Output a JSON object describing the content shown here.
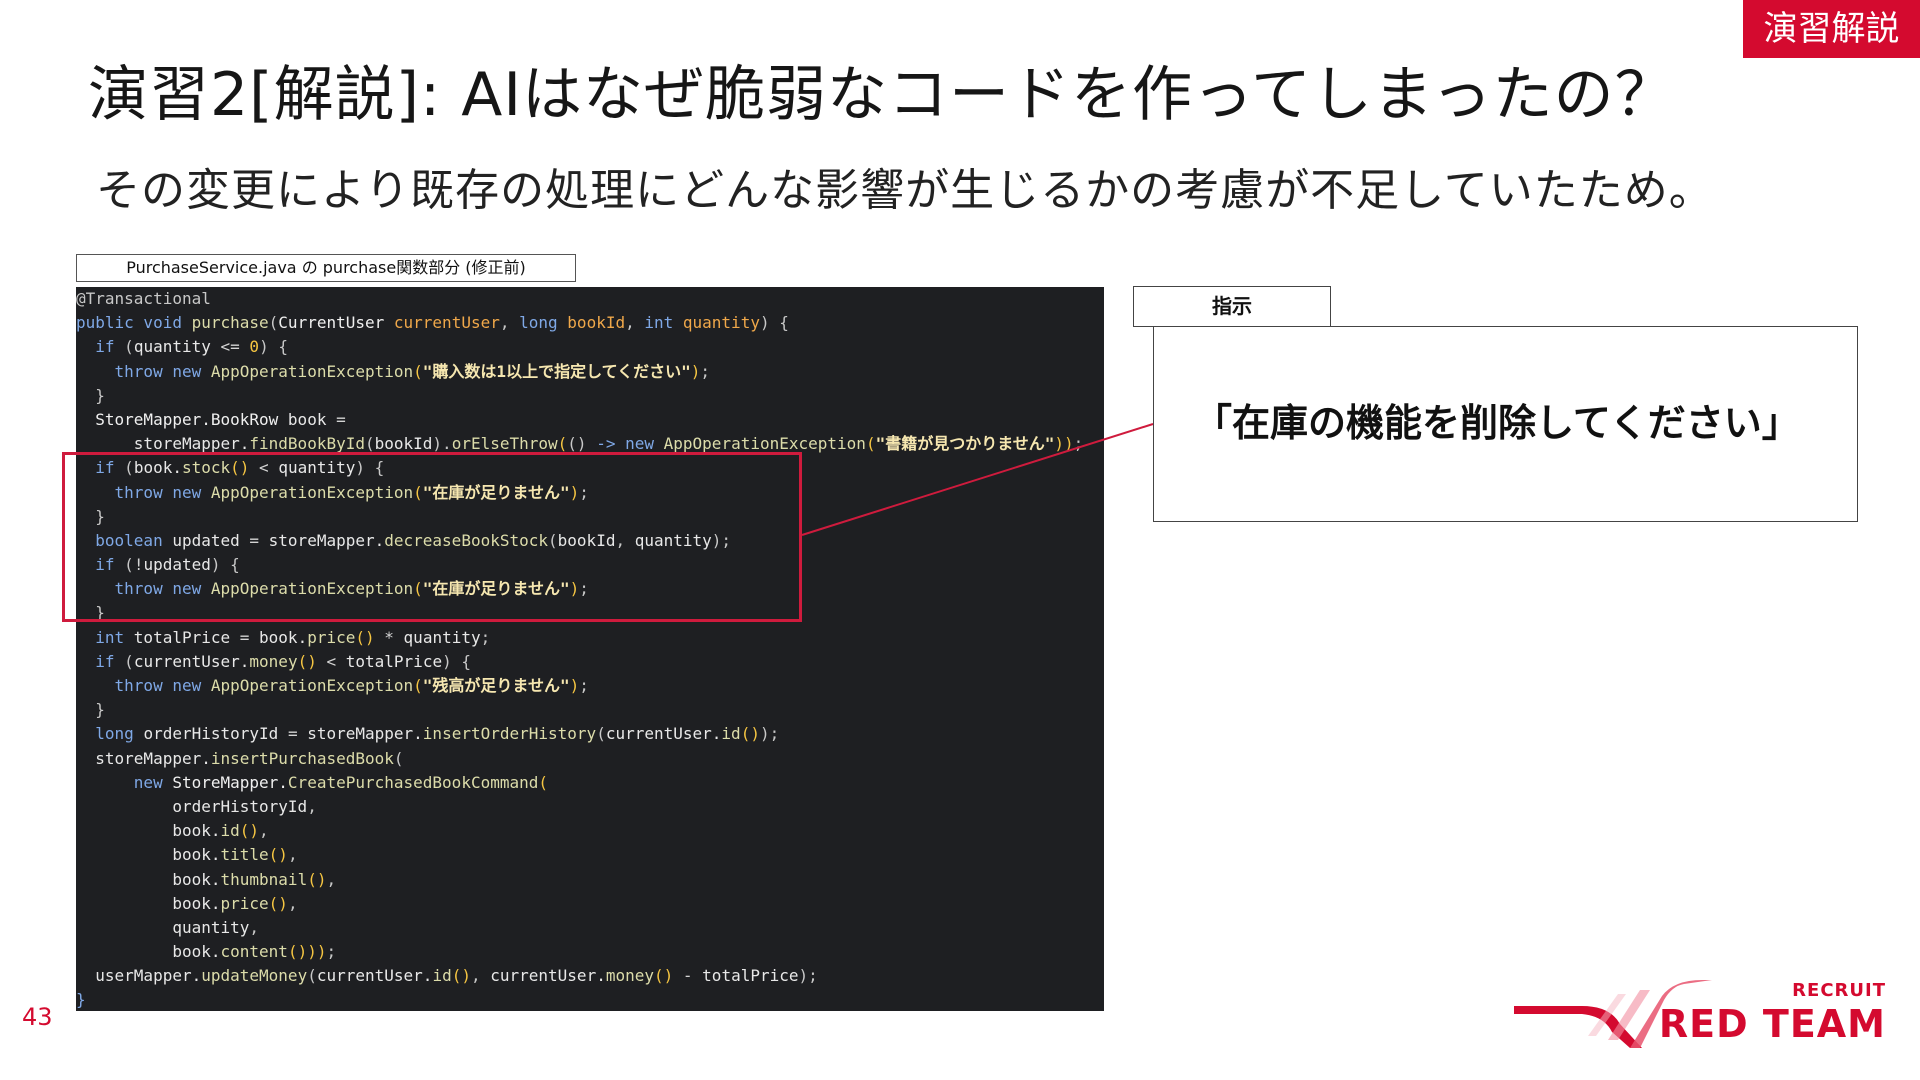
{
  "header": {
    "tag": "演習解説",
    "title": "演習2[解説]: AIはなぜ脆弱なコードを作ってしまったの？",
    "subtitle": "その変更により既存の処理にどんな影響が生じるかの考慮が不足していたため。"
  },
  "code": {
    "caption": "PurchaseService.java の purchase関数部分 (修正前)",
    "lines": [
      [
        [
          "an",
          "@Transactional"
        ]
      ],
      [
        [
          "kw",
          "public void "
        ],
        [
          "fn",
          "purchase"
        ],
        [
          "pu",
          "("
        ],
        [
          "ty",
          "CurrentUser "
        ],
        [
          "pa",
          "currentUser"
        ],
        [
          "pu",
          ", "
        ],
        [
          "kw",
          "long "
        ],
        [
          "pa",
          "bookId"
        ],
        [
          "pu",
          ", "
        ],
        [
          "kw",
          "int "
        ],
        [
          "pa",
          "quantity"
        ],
        [
          "pu",
          ") {"
        ]
      ],
      [
        [
          "tx",
          "  "
        ],
        [
          "kw",
          "if "
        ],
        [
          "pu",
          "("
        ],
        [
          "id",
          "quantity "
        ],
        [
          "tx",
          "<= "
        ],
        [
          "br",
          "0"
        ],
        [
          "pu",
          ") {"
        ]
      ],
      [
        [
          "tx",
          "    "
        ],
        [
          "kw",
          "throw new "
        ],
        [
          "fn",
          "AppOperationException"
        ],
        [
          "br",
          "("
        ],
        [
          "st",
          "\"購入数は1以上で指定してください\""
        ],
        [
          "br",
          ")"
        ],
        [
          "pu",
          ";"
        ]
      ],
      [
        [
          "tx",
          "  "
        ],
        [
          "pu",
          "}"
        ]
      ],
      [
        [
          "tx",
          "  "
        ],
        [
          "ty",
          "StoreMapper.BookRow "
        ],
        [
          "id",
          "book "
        ],
        [
          "tx",
          "="
        ]
      ],
      [
        [
          "tx",
          "      "
        ],
        [
          "id",
          "storeMapper."
        ],
        [
          "fn",
          "findBookById"
        ],
        [
          "pu",
          "("
        ],
        [
          "id",
          "bookId"
        ],
        [
          "pu",
          ")."
        ],
        [
          "fn",
          "orElseThrow"
        ],
        [
          "br",
          "("
        ],
        [
          "pu",
          "() "
        ],
        [
          "kw",
          "-> new "
        ],
        [
          "fn",
          "AppOperationException"
        ],
        [
          "br",
          "("
        ],
        [
          "st",
          "\"書籍が見つかりません\""
        ],
        [
          "br",
          "))"
        ],
        [
          "pu",
          ";"
        ]
      ],
      [
        [
          "tx",
          "  "
        ],
        [
          "kw",
          "if "
        ],
        [
          "pu",
          "("
        ],
        [
          "id",
          "book."
        ],
        [
          "fn",
          "stock"
        ],
        [
          "br",
          "()"
        ],
        [
          "tx",
          " < "
        ],
        [
          "id",
          "quantity"
        ],
        [
          "pu",
          ") {"
        ]
      ],
      [
        [
          "tx",
          "    "
        ],
        [
          "kw",
          "throw new "
        ],
        [
          "fn",
          "AppOperationException"
        ],
        [
          "br",
          "("
        ],
        [
          "st",
          "\"在庫が足りません\""
        ],
        [
          "br",
          ")"
        ],
        [
          "pu",
          ";"
        ]
      ],
      [
        [
          "tx",
          "  "
        ],
        [
          "pu",
          "}"
        ]
      ],
      [
        [
          "tx",
          "  "
        ],
        [
          "kw",
          "boolean "
        ],
        [
          "id",
          "updated "
        ],
        [
          "tx",
          "= "
        ],
        [
          "id",
          "storeMapper."
        ],
        [
          "fn",
          "decreaseBookStock"
        ],
        [
          "pu",
          "("
        ],
        [
          "id",
          "bookId"
        ],
        [
          "pu",
          ", "
        ],
        [
          "id",
          "quantity"
        ],
        [
          "pu",
          ");"
        ]
      ],
      [
        [
          "tx",
          "  "
        ],
        [
          "kw",
          "if "
        ],
        [
          "pu",
          "("
        ],
        [
          "tx",
          "!"
        ],
        [
          "id",
          "updated"
        ],
        [
          "pu",
          ") {"
        ]
      ],
      [
        [
          "tx",
          "    "
        ],
        [
          "kw",
          "throw new "
        ],
        [
          "fn",
          "AppOperationException"
        ],
        [
          "br",
          "("
        ],
        [
          "st",
          "\"在庫が足りません\""
        ],
        [
          "br",
          ")"
        ],
        [
          "pu",
          ";"
        ]
      ],
      [
        [
          "tx",
          "  "
        ],
        [
          "pu",
          "}"
        ]
      ],
      [
        [
          "tx",
          "  "
        ],
        [
          "kw",
          "int "
        ],
        [
          "id",
          "totalPrice "
        ],
        [
          "tx",
          "= "
        ],
        [
          "id",
          "book."
        ],
        [
          "fn",
          "price"
        ],
        [
          "br",
          "()"
        ],
        [
          "tx",
          " * "
        ],
        [
          "id",
          "quantity"
        ],
        [
          "pu",
          ";"
        ]
      ],
      [
        [
          "tx",
          "  "
        ],
        [
          "kw",
          "if "
        ],
        [
          "pu",
          "("
        ],
        [
          "id",
          "currentUser."
        ],
        [
          "fn",
          "money"
        ],
        [
          "br",
          "()"
        ],
        [
          "tx",
          " < "
        ],
        [
          "id",
          "totalPrice"
        ],
        [
          "pu",
          ") {"
        ]
      ],
      [
        [
          "tx",
          "    "
        ],
        [
          "kw",
          "throw new "
        ],
        [
          "fn",
          "AppOperationException"
        ],
        [
          "br",
          "("
        ],
        [
          "st",
          "\"残高が足りません\""
        ],
        [
          "br",
          ")"
        ],
        [
          "pu",
          ";"
        ]
      ],
      [
        [
          "tx",
          "  "
        ],
        [
          "pu",
          "}"
        ]
      ],
      [
        [
          "tx",
          "  "
        ],
        [
          "kw",
          "long "
        ],
        [
          "id",
          "orderHistoryId "
        ],
        [
          "tx",
          "= "
        ],
        [
          "id",
          "storeMapper."
        ],
        [
          "fn",
          "insertOrderHistory"
        ],
        [
          "pu",
          "("
        ],
        [
          "id",
          "currentUser."
        ],
        [
          "fn",
          "id"
        ],
        [
          "br",
          "()"
        ],
        [
          "pu",
          ");"
        ]
      ],
      [
        [
          "tx",
          "  "
        ],
        [
          "id",
          "storeMapper."
        ],
        [
          "fn",
          "insertPurchasedBook"
        ],
        [
          "pu",
          "("
        ]
      ],
      [
        [
          "tx",
          "      "
        ],
        [
          "kw",
          "new "
        ],
        [
          "ty",
          "StoreMapper."
        ],
        [
          "fn",
          "CreatePurchasedBookCommand"
        ],
        [
          "br",
          "("
        ]
      ],
      [
        [
          "tx",
          "          "
        ],
        [
          "id",
          "orderHistoryId"
        ],
        [
          "pu",
          ","
        ]
      ],
      [
        [
          "tx",
          "          "
        ],
        [
          "id",
          "book."
        ],
        [
          "fn",
          "id"
        ],
        [
          "br",
          "()"
        ],
        [
          "pu",
          ","
        ]
      ],
      [
        [
          "tx",
          "          "
        ],
        [
          "id",
          "book."
        ],
        [
          "fn",
          "title"
        ],
        [
          "br",
          "()"
        ],
        [
          "pu",
          ","
        ]
      ],
      [
        [
          "tx",
          "          "
        ],
        [
          "id",
          "book."
        ],
        [
          "fn",
          "thumbnail"
        ],
        [
          "br",
          "()"
        ],
        [
          "pu",
          ","
        ]
      ],
      [
        [
          "tx",
          "          "
        ],
        [
          "id",
          "book."
        ],
        [
          "fn",
          "price"
        ],
        [
          "br",
          "()"
        ],
        [
          "pu",
          ","
        ]
      ],
      [
        [
          "tx",
          "          "
        ],
        [
          "id",
          "quantity"
        ],
        [
          "pu",
          ","
        ]
      ],
      [
        [
          "tx",
          "          "
        ],
        [
          "id",
          "book."
        ],
        [
          "fn",
          "content"
        ],
        [
          "br",
          "()))"
        ],
        [
          "pu",
          ";"
        ]
      ],
      [
        [
          "tx",
          "  "
        ],
        [
          "id",
          "userMapper."
        ],
        [
          "fn",
          "updateMoney"
        ],
        [
          "pu",
          "("
        ],
        [
          "id",
          "currentUser."
        ],
        [
          "fn",
          "id"
        ],
        [
          "br",
          "()"
        ],
        [
          "pu",
          ", "
        ],
        [
          "id",
          "currentUser."
        ],
        [
          "fn",
          "money"
        ],
        [
          "br",
          "()"
        ],
        [
          "tx",
          " - "
        ],
        [
          "id",
          "totalPrice"
        ],
        [
          "pu",
          ");"
        ]
      ],
      [
        [
          "kw",
          "}"
        ]
      ]
    ]
  },
  "instruction": {
    "label": "指示",
    "text": "「在庫の機能を削除してください」"
  },
  "footer": {
    "page_number": "43",
    "logo_top": "RECRUIT",
    "logo_bottom": "RED TEAM"
  },
  "colors": {
    "accent": "#d40a2f",
    "highlight_border": "#cf1b3d",
    "code_background": "#1e1f22"
  }
}
